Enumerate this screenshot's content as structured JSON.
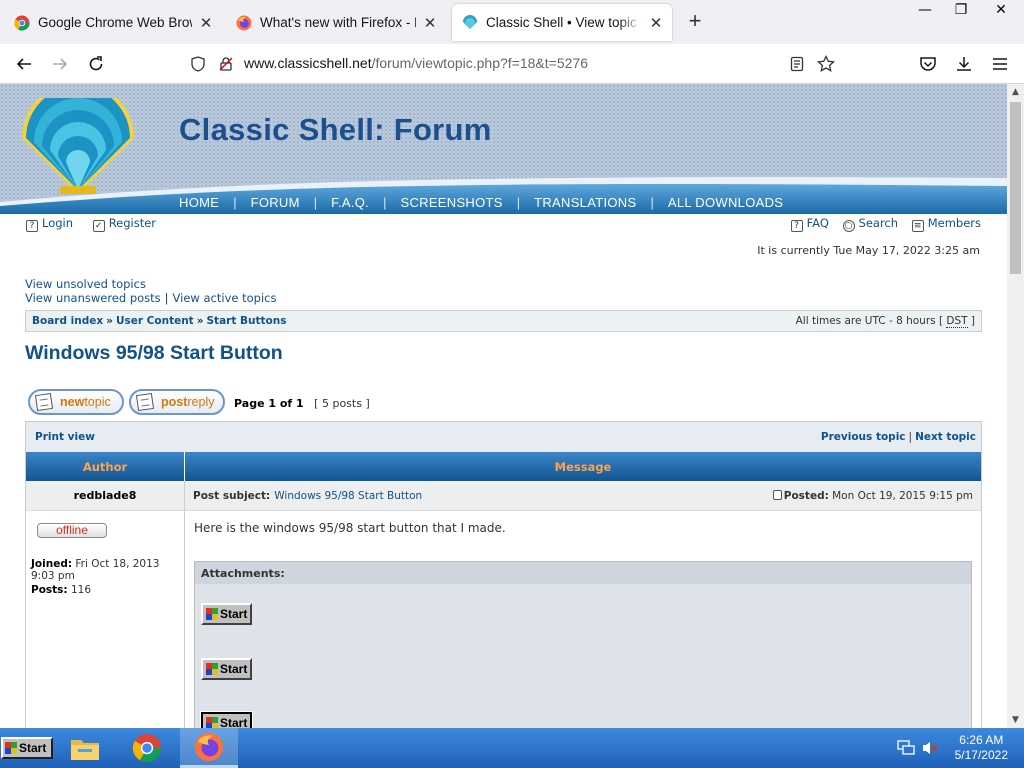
{
  "browser": {
    "tabs": [
      {
        "title": "Google Chrome Web Browser",
        "icon": "chrome-favicon"
      },
      {
        "title": "What's new with Firefox - More",
        "icon": "firefox-favicon"
      },
      {
        "title": "Classic Shell • View topic - Windo",
        "icon": "classic-shell-favicon",
        "active": true
      }
    ],
    "url_host": "www.classicshell.net",
    "url_path": "/forum/viewtopic.php?f=18&t=5276"
  },
  "site": {
    "title": "Classic Shell: Forum",
    "nav": [
      "HOME",
      "FORUM",
      "F.A.Q.",
      "SCREENSHOTS",
      "TRANSLATIONS",
      "ALL DOWNLOADS"
    ]
  },
  "user_links": {
    "login": "Login",
    "register": "Register"
  },
  "right_links": {
    "faq": "FAQ",
    "search": "Search",
    "members": "Members"
  },
  "current_time": "It is currently Tue May 17, 2022 3:25 am",
  "quick_links": {
    "unsolved": "View unsolved topics",
    "unanswered": "View unanswered posts",
    "separator": "|",
    "active": "View active topics"
  },
  "breadcrumb": {
    "items": [
      "Board index",
      "User Content",
      "Start Buttons"
    ],
    "sep": "»",
    "times_prefix": "All times are UTC - 8 hours [ ",
    "dst": "DST",
    "times_suffix": " ]"
  },
  "topic": {
    "title": "Windows 95/98 Start Button",
    "new_topic_1": "new",
    "new_topic_2": "topic",
    "post_reply_1": "post",
    "post_reply_2": "reply",
    "page_label": "Page 1 of 1",
    "post_count": "[ 5 posts ]"
  },
  "table": {
    "print_view": "Print view",
    "previous_topic": "Previous topic",
    "sep": "|",
    "next_topic": "Next topic",
    "col_author": "Author",
    "col_message": "Message"
  },
  "post": {
    "author": "redblade8",
    "subject_label": "Post subject:",
    "subject": "Windows 95/98 Start Button",
    "posted_label": "Posted:",
    "posted_date": "Mon Oct 19, 2015 9:15 pm",
    "status": "offline",
    "joined_label": "Joined:",
    "joined_value": "Fri Oct 18, 2013 9:03 pm",
    "posts_label": "Posts:",
    "posts_value": "116",
    "body": "Here is the windows 95/98 start button that I made.",
    "attachments_label": "Attachments:",
    "attachment_label": "Start"
  },
  "taskbar": {
    "start_label": "Start",
    "apps": [
      "file-explorer-icon",
      "chrome-icon",
      "firefox-icon"
    ],
    "time": "6:26 AM",
    "date": "5/17/2022"
  },
  "colors": {
    "link": "#105289",
    "header_blue": "#1c4f8c",
    "table_head": "#1c64a6",
    "table_head_text": "#ffa34f",
    "taskbar": "#2b74c8"
  }
}
